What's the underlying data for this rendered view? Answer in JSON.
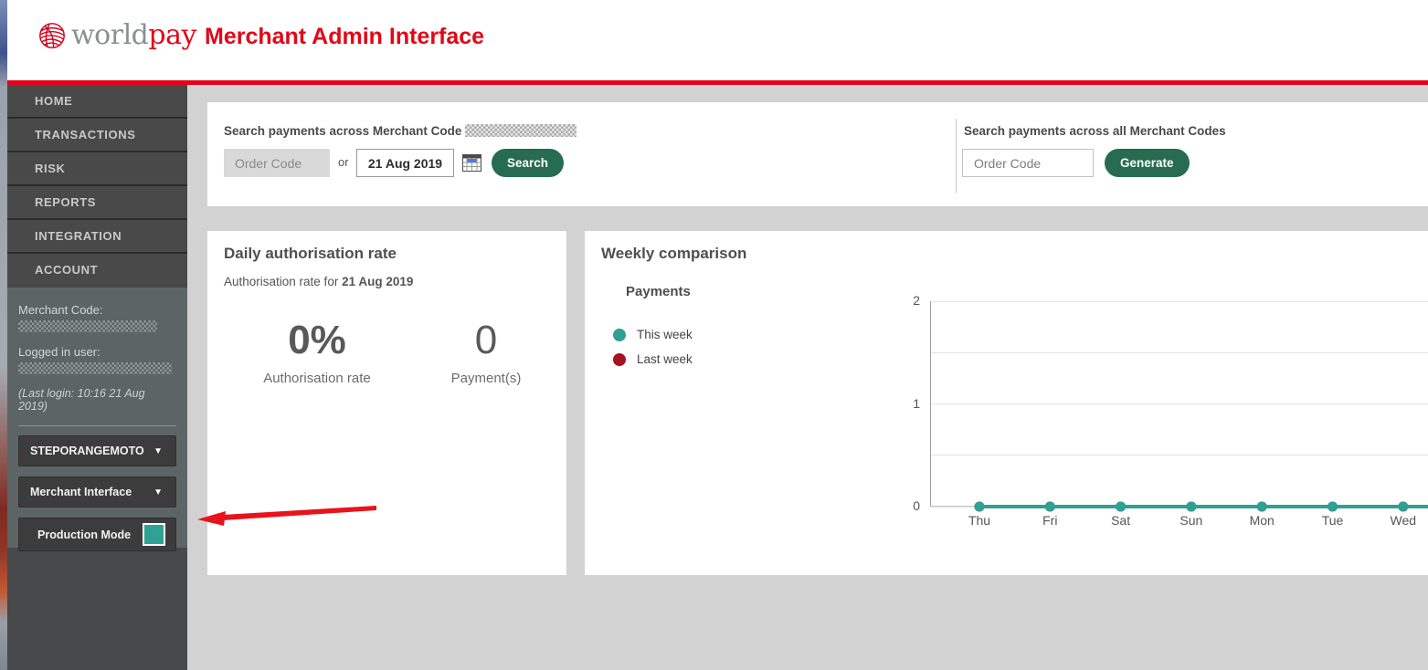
{
  "header": {
    "logo_world": "world",
    "logo_pay": "pay",
    "title": "Merchant Admin Interface"
  },
  "sidebar": {
    "nav_items": [
      "HOME",
      "TRANSACTIONS",
      "RISK",
      "REPORTS",
      "INTEGRATION",
      "ACCOUNT"
    ],
    "merchant_code_label": "Merchant Code:",
    "logged_in_user_label": "Logged in user:",
    "last_login": "(Last login: 10:16 21 Aug 2019)",
    "merchant_dropdown_value": "STEPORANGEMOTO",
    "interface_dropdown_value": "Merchant Interface",
    "production_mode_label": "Production Mode",
    "dropdown_chevron": "▼"
  },
  "search_panel": {
    "left_title": "Search payments across Merchant Code",
    "order_code_placeholder": "Order Code",
    "or_label": "or",
    "date_value": "21 Aug 2019",
    "search_button": "Search",
    "right_title": "Search payments across all Merchant Codes",
    "right_order_code_placeholder": "Order Code",
    "generate_button": "Generate"
  },
  "daily_card": {
    "title": "Daily authorisation rate",
    "subtitle_prefix": "Authorisation rate for ",
    "subtitle_date": "21 Aug 2019",
    "rate_value": "0%",
    "rate_label": "Authorisation rate",
    "payments_value": "0",
    "payments_label": "Payment(s)"
  },
  "weekly_card": {
    "title": "Weekly comparison",
    "section_label": "Payments",
    "legend": [
      {
        "label": "This week",
        "color": "#2fa093"
      },
      {
        "label": "Last week",
        "color": "#a51220"
      }
    ]
  },
  "chart_data": {
    "type": "line",
    "title": "Payments",
    "categories": [
      "Thu",
      "Fri",
      "Sat",
      "Sun",
      "Mon",
      "Tue",
      "Wed"
    ],
    "series": [
      {
        "name": "This week",
        "color": "#2fa093",
        "values": [
          0,
          0,
          0,
          0,
          0,
          0,
          0
        ]
      },
      {
        "name": "Last week",
        "color": "#a51220",
        "values": [
          0,
          0,
          0,
          0,
          0,
          0,
          0
        ]
      }
    ],
    "xlabel": "",
    "ylabel": "",
    "ylim": [
      0,
      2
    ],
    "yticks": [
      0,
      1,
      2
    ],
    "gridlines": [
      0,
      0.5,
      1,
      1.5,
      2
    ],
    "grid": true,
    "legend_position": "left"
  },
  "colors": {
    "brand_red": "#e30617",
    "header_rule_red": "#e60018",
    "teal": "#2fa093",
    "dark_red": "#a51220",
    "button_green": "#266b52",
    "production_toggle": "#2fa295",
    "annotation_arrow_red": "#e8131b"
  }
}
